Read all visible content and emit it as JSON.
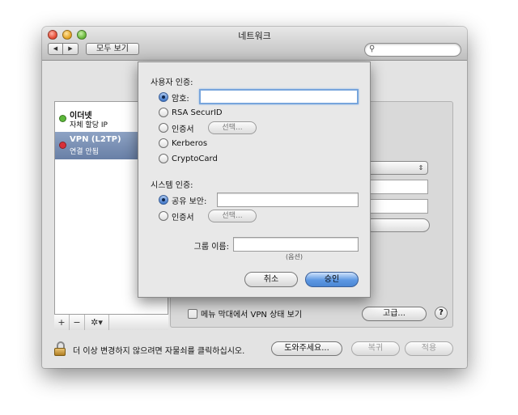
{
  "window": {
    "title": "네트워크",
    "nav_back": "◀",
    "nav_forward": "▶",
    "show_all": "모두 보기",
    "search": {
      "placeholder": "",
      "icon": "magnifier-icon"
    }
  },
  "services": [
    {
      "name": "이더넷",
      "status": "자체 할당 IP",
      "status_color": "#5cb83a"
    },
    {
      "name": "VPN (L2TP)",
      "status": "연결 안됨",
      "status_color": "#d8303a",
      "selected": true
    }
  ],
  "service_bar": {
    "add": "+",
    "remove": "−",
    "action": "✲▾"
  },
  "detail": {
    "show_vpn_status_label": "메뉴 막대에서 VPN 상태 보기",
    "advanced_button": "고급...",
    "help_button": "?"
  },
  "footer": {
    "lock_text": "더 이상 변경하지 않으려면 자물쇠를 클릭하십시오.",
    "assist_button": "도와주세요...",
    "revert_button": "복귀",
    "apply_button": "적용"
  },
  "auth_sheet": {
    "user_auth_title": "사용자 인증:",
    "user_options": [
      "암호:",
      "RSA SecurID",
      "인증서",
      "Kerberos",
      "CryptoCard"
    ],
    "user_selected_index": 0,
    "user_cert_choose": "선택...",
    "machine_auth_title": "시스템 인증:",
    "machine_options": [
      "공유 보안:",
      "인증서"
    ],
    "machine_selected_index": 0,
    "machine_cert_choose": "선택...",
    "group_name_label": "그룹 이름:",
    "group_name_hint": "(옵션)",
    "cancel_button": "취소",
    "ok_button": "승인"
  },
  "colors": {
    "accent": "#5c97e2",
    "selection": "#768cb0"
  }
}
